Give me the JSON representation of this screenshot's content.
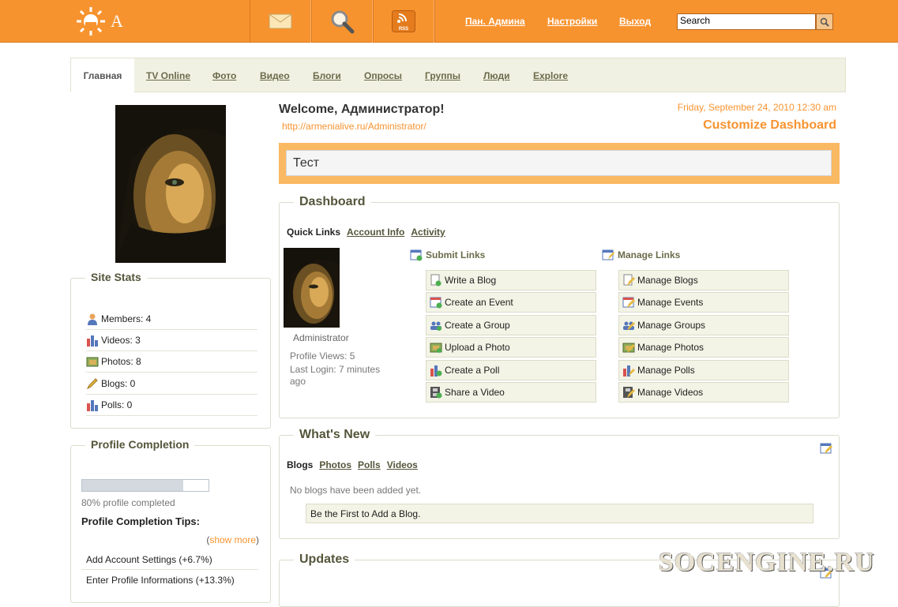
{
  "header": {
    "logo_text": "A",
    "links": [
      "Пан. Админа",
      "Настройки",
      "Выход"
    ],
    "search_placeholder": "Search",
    "rss_label": "RSS",
    "accent": "#f7932f"
  },
  "tabs": [
    "Главная",
    "TV Online",
    "Фото",
    "Видео",
    "Блоги",
    "Опросы",
    "Группы",
    "Люди",
    "Explore"
  ],
  "sidebar": {
    "site_stats_title": "Site Stats",
    "stats": [
      {
        "icon": "members-icon",
        "text": "Members: 4"
      },
      {
        "icon": "videos-icon",
        "text": "Videos: 3"
      },
      {
        "icon": "photos-icon",
        "text": "Photos: 8"
      },
      {
        "icon": "blogs-icon",
        "text": "Blogs: 0"
      },
      {
        "icon": "polls-icon",
        "text": "Polls: 0"
      }
    ],
    "profile_completion_title": "Profile Completion",
    "completion_percent": 80,
    "completion_text": "80% profile completed",
    "tips_title": "Profile Completion Tips:",
    "show_more_open": "(",
    "show_more": "show more",
    "show_more_close": ")",
    "tips": [
      "Add Account Settings (+6.7%)",
      "Enter Profile Informations (+13.3%)"
    ]
  },
  "main": {
    "welcome": "Welcome, Администратор!",
    "profile_url": "http://armenialive.ru/Administrator/",
    "datetime": "Friday, September 24, 2010 12:30 am",
    "customize": "Customize Dashboard",
    "status_text": "Тест"
  },
  "dashboard": {
    "title": "Dashboard",
    "tabs": [
      "Quick Links",
      "Account Info",
      "Activity"
    ],
    "user_name": "Administrator",
    "profile_views": "Profile Views: 5",
    "last_login_line1": "Last Login: 7 minutes",
    "last_login_line2": "ago",
    "submit_title": "Submit Links",
    "manage_title": "Manage Links",
    "submit_links": [
      "Write a Blog",
      "Create an Event",
      "Create a Group",
      "Upload a Photo",
      "Create a Poll",
      "Share a Video"
    ],
    "manage_links": [
      "Manage Blogs",
      "Manage Events",
      "Manage Groups",
      "Manage Photos",
      "Manage Polls",
      "Manage Videos"
    ]
  },
  "whats_new": {
    "title": "What's New",
    "tabs": [
      "Blogs",
      "Photos",
      "Polls",
      "Videos"
    ],
    "empty_text": "No blogs have been added yet.",
    "first_link": "Be the First to Add a Blog."
  },
  "updates": {
    "title": "Updates"
  },
  "watermark": "SOCENGINE.RU"
}
